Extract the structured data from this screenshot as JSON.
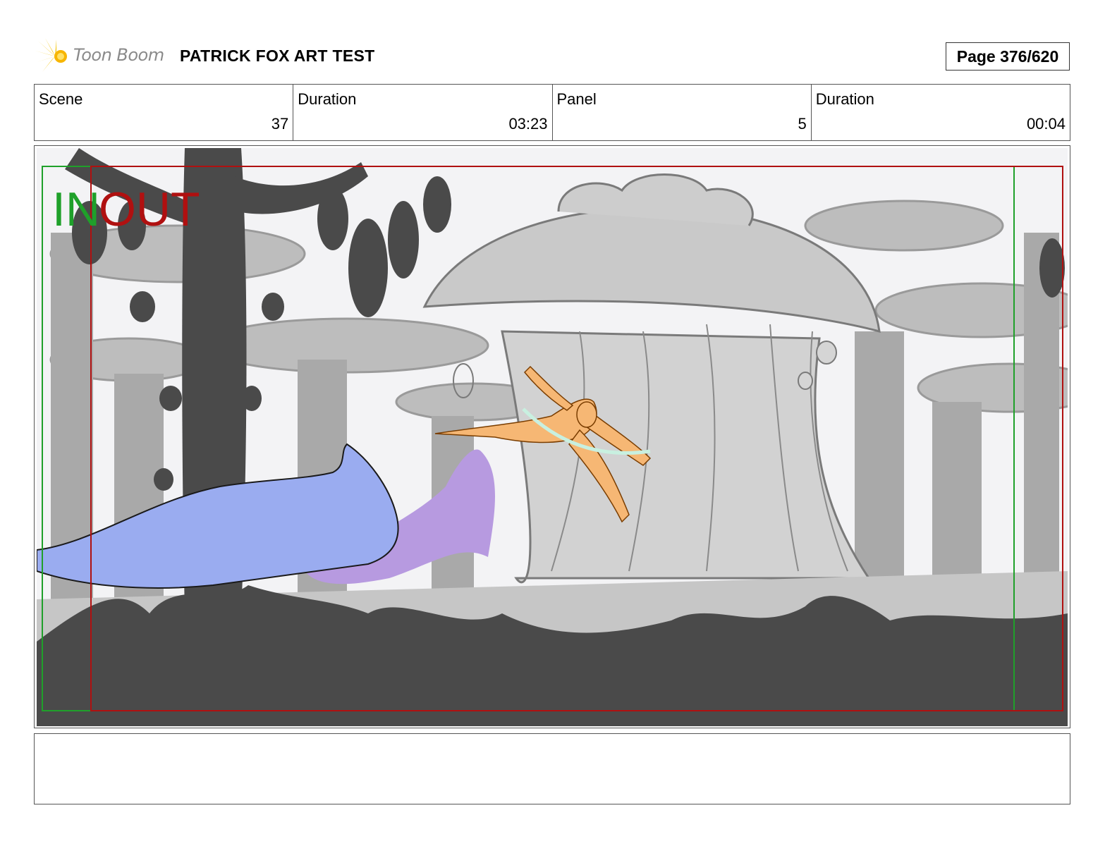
{
  "header": {
    "logo_text": "Toon Boom",
    "project_title": "PATRICK FOX ART TEST",
    "page_label": "Page 376/620"
  },
  "info": {
    "scene_label": "Scene",
    "scene_value": "37",
    "scene_duration_label": "Duration",
    "scene_duration_value": "03:23",
    "panel_label": "Panel",
    "panel_value": "5",
    "panel_duration_label": "Duration",
    "panel_duration_value": "00:04"
  },
  "panel": {
    "in_marker": "IN",
    "out_marker": "OUT",
    "colors": {
      "in": "#1fa02a",
      "out": "#b01010",
      "foreground": "#4a4a4a",
      "background_mid": "#b5b5b5",
      "creature_blue": "#9aacf0",
      "creature_purple": "#b79ae0",
      "hero_orange": "#f6b774"
    }
  },
  "notes": {
    "text": ""
  }
}
